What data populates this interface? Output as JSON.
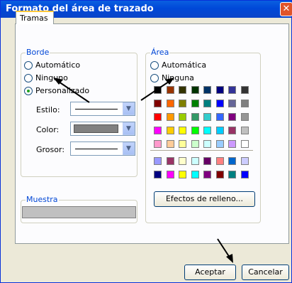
{
  "window": {
    "title": "Formato del área de trazado",
    "close_glyph": "✕"
  },
  "tabs": [
    {
      "label": "Tramas"
    }
  ],
  "borde": {
    "legend": "Borde",
    "options": [
      "Automático",
      "Ninguno",
      "Personalizado"
    ],
    "selected": "Personalizado",
    "estilo_label": "Estilo:",
    "color_label": "Color:",
    "grosor_label": "Grosor:",
    "color_value": "#808080"
  },
  "area": {
    "legend": "Área",
    "options": [
      "Automática",
      "Ninguna"
    ],
    "effects_button": "Efectos de relleno...",
    "palette_rows": [
      [
        "#000000",
        "#993300",
        "#333300",
        "#003300",
        "#003366",
        "#000080",
        "#333399",
        "#333333"
      ],
      [
        "#800000",
        "#ff6600",
        "#808000",
        "#008000",
        "#008080",
        "#0000ff",
        "#666699",
        "#808080"
      ],
      [
        "#ff0000",
        "#ff9900",
        "#99cc00",
        "#339966",
        "#33cccc",
        "#3366ff",
        "#800080",
        "#969696"
      ],
      [
        "#ff00ff",
        "#ffcc00",
        "#ffff00",
        "#00ff00",
        "#00ffff",
        "#00ccff",
        "#993366",
        "#c0c0c0"
      ],
      [
        "#ff99cc",
        "#ffcc99",
        "#ffff99",
        "#ccffcc",
        "#ccffff",
        "#99ccff",
        "#cc99ff",
        "#ffffff"
      ]
    ],
    "extra_rows": [
      [
        "#9999ff",
        "#993366",
        "#ffffcc",
        "#ccffff",
        "#660066",
        "#ff8080",
        "#0066cc",
        "#ccccff"
      ],
      [
        "#000080",
        "#ff00ff",
        "#ffff00",
        "#00ffff",
        "#800080",
        "#800000",
        "#008080",
        "#0000ff"
      ]
    ]
  },
  "muestra": {
    "legend": "Muestra",
    "fill": "#c0c0c0"
  },
  "buttons": {
    "ok": "Aceptar",
    "cancel": "Cancelar"
  },
  "icons": {
    "dropdown": "chevron-down-icon",
    "close": "close-icon",
    "annotation": "arrow-annotation"
  }
}
